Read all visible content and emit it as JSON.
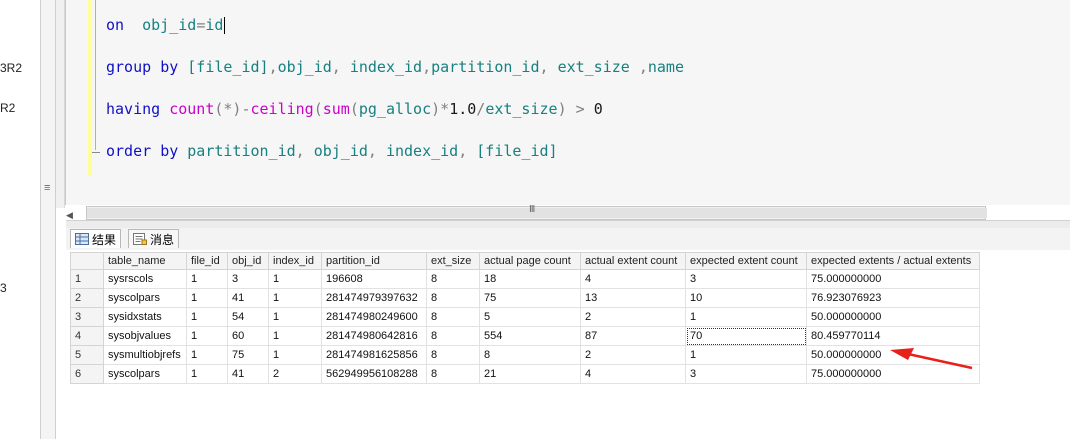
{
  "left_panel": {
    "fragments": [
      "3R2",
      "R2",
      "3"
    ]
  },
  "editor": {
    "lines": [
      {
        "parts": [
          [
            "kw",
            "on"
          ],
          [
            "",
            "  "
          ],
          [
            "id",
            "obj_id"
          ],
          [
            "op",
            "="
          ],
          [
            "id",
            "id"
          ]
        ]
      },
      {
        "parts": [
          [
            "kw",
            "group"
          ],
          [
            "",
            " "
          ],
          [
            "kw",
            "by"
          ],
          [
            "",
            " "
          ],
          [
            "id",
            "[file_id]"
          ],
          [
            "op",
            ","
          ],
          [
            "id",
            "obj_id"
          ],
          [
            "op",
            ","
          ],
          [
            "",
            " "
          ],
          [
            "id",
            "index_id"
          ],
          [
            "op",
            ","
          ],
          [
            "id",
            "partition_id"
          ],
          [
            "op",
            ","
          ],
          [
            "",
            " "
          ],
          [
            "id",
            "ext_size"
          ],
          [
            "",
            " "
          ],
          [
            "op",
            ","
          ],
          [
            "id",
            "name"
          ]
        ]
      },
      {
        "parts": [
          [
            "kw",
            "having"
          ],
          [
            "",
            " "
          ],
          [
            "fn",
            "count"
          ],
          [
            "op",
            "(*)-"
          ],
          [
            "fn",
            "ceiling"
          ],
          [
            "op",
            "("
          ],
          [
            "fn",
            "sum"
          ],
          [
            "op",
            "("
          ],
          [
            "id",
            "pg_alloc"
          ],
          [
            "op",
            ")*"
          ],
          [
            "",
            "1.0"
          ],
          [
            "op",
            "/"
          ],
          [
            "id",
            "ext_size"
          ],
          [
            "op",
            ")"
          ],
          [
            "",
            " "
          ],
          [
            "op",
            ">"
          ],
          [
            "",
            " "
          ],
          [
            "",
            "0"
          ]
        ]
      },
      {
        "parts": [
          [
            "kw",
            "order"
          ],
          [
            "",
            " "
          ],
          [
            "kw",
            "by"
          ],
          [
            "",
            " "
          ],
          [
            "id",
            "partition_id"
          ],
          [
            "op",
            ","
          ],
          [
            "",
            " "
          ],
          [
            "id",
            "obj_id"
          ],
          [
            "op",
            ","
          ],
          [
            "",
            " "
          ],
          [
            "id",
            "index_id"
          ],
          [
            "op",
            ","
          ],
          [
            "",
            " "
          ],
          [
            "id",
            "[file_id]"
          ]
        ]
      }
    ]
  },
  "hscroll": {
    "grip": "III"
  },
  "tabs": [
    {
      "label": "结果",
      "icon": "grid-icon",
      "active": true
    },
    {
      "label": "消息",
      "icon": "messages-icon",
      "active": false
    }
  ],
  "results": {
    "columns": [
      "table_name",
      "file_id",
      "obj_id",
      "index_id",
      "partition_id",
      "ext_size",
      "actual page count",
      "actual extent count",
      "expected extent count",
      "expected extents / actual extents"
    ],
    "rows": [
      [
        "1",
        "sysrscols",
        "1",
        "3",
        "1",
        "196608",
        "8",
        "18",
        "4",
        "3",
        "75.000000000"
      ],
      [
        "2",
        "syscolpars",
        "1",
        "41",
        "1",
        "281474979397632",
        "8",
        "75",
        "13",
        "10",
        "76.923076923"
      ],
      [
        "3",
        "sysidxstats",
        "1",
        "54",
        "1",
        "281474980249600",
        "8",
        "5",
        "2",
        "1",
        "50.000000000"
      ],
      [
        "4",
        "sysobjvalues",
        "1",
        "60",
        "1",
        "281474980642816",
        "8",
        "554",
        "87",
        "70",
        "80.459770114"
      ],
      [
        "5",
        "sysmultiobjrefs",
        "1",
        "75",
        "1",
        "281474981625856",
        "8",
        "8",
        "2",
        "1",
        "50.000000000"
      ],
      [
        "6",
        "syscolpars",
        "1",
        "41",
        "2",
        "562949956108288",
        "8",
        "21",
        "4",
        "3",
        "75.000000000"
      ]
    ],
    "selected_cell": {
      "row": 4,
      "col": 9
    }
  },
  "colors": {
    "keyword": "#1010c8",
    "identifier": "#188080",
    "function": "#cc00cc",
    "operator": "#808080",
    "arrow": "#e8201a"
  }
}
